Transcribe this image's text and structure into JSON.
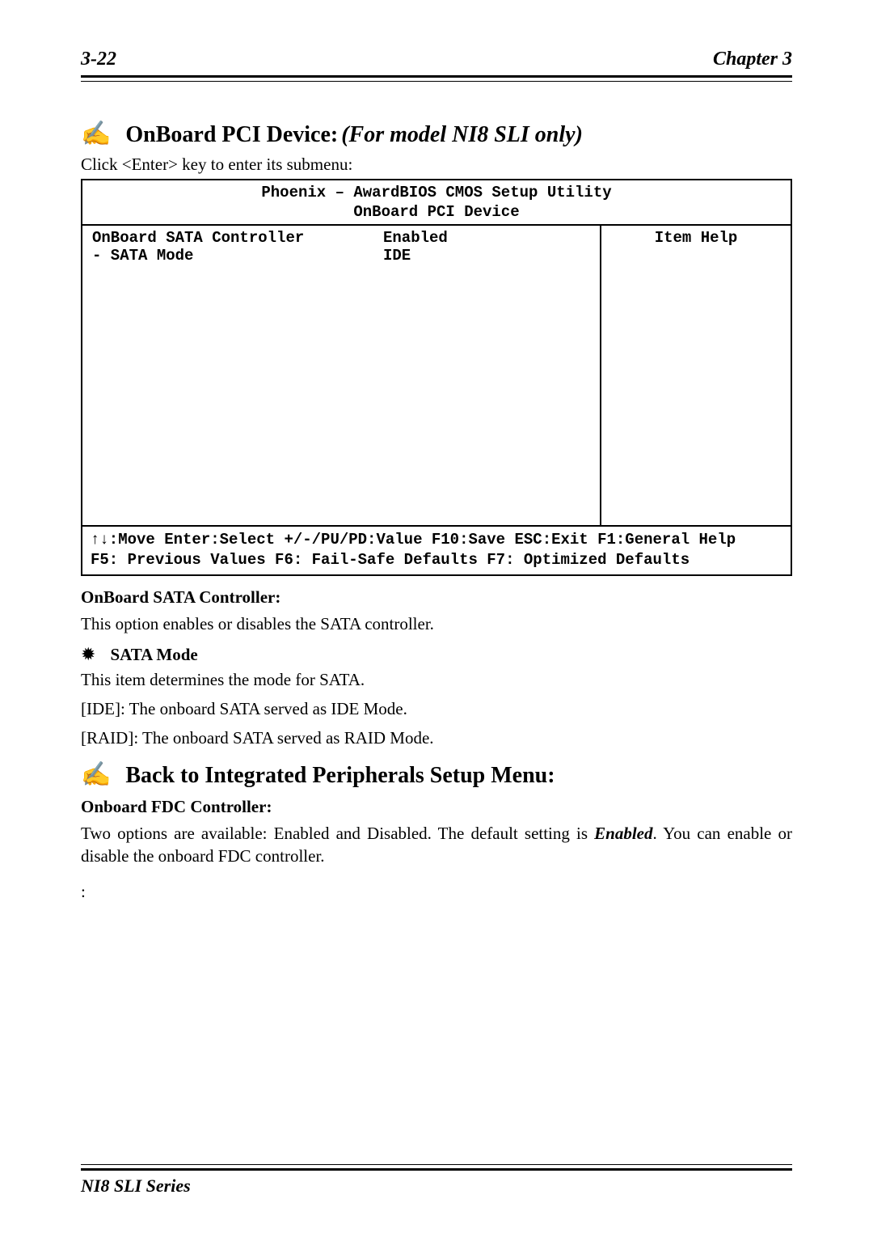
{
  "header": {
    "page_num": "3-22",
    "chapter": "Chapter 3"
  },
  "sec1": {
    "icon": "✍",
    "title": "OnBoard PCI Device:",
    "subtitle": "(For model NI8 SLI only)",
    "intro": "Click <Enter> key to enter its submenu:"
  },
  "bios": {
    "title_line1": "Phoenix – AwardBIOS CMOS Setup Utility",
    "title_line2": "OnBoard PCI Device",
    "row1_label": "OnBoard SATA Controller",
    "row1_value": "Enabled",
    "row2_label": "- SATA Mode",
    "row2_value": "IDE",
    "help_header": "Item Help",
    "footer_line1": "↑↓:Move Enter:Select +/-/PU/PD:Value F10:Save ESC:Exit F1:General Help",
    "footer_line2": "F5: Previous Values   F6: Fail-Safe Defaults   F7: Optimized Defaults"
  },
  "sata_ctrl": {
    "heading": "OnBoard SATA Controller:",
    "desc": "This option enables or disables the SATA controller."
  },
  "sata_mode": {
    "star": "✹",
    "label": "SATA Mode",
    "l1": "This item determines the mode for SATA.",
    "l2": "[IDE]: The onboard SATA served as IDE Mode.",
    "l3": "[RAID]: The onboard SATA served as RAID Mode."
  },
  "sec2": {
    "icon": "✍",
    "title": "Back to Integrated Peripherals Setup Menu:"
  },
  "fdc": {
    "heading": "Onboard FDC Controller:",
    "desc_pre": "Two options are available: Enabled and Disabled. The default setting is ",
    "emph": "Enabled",
    "desc_post": ". You can enable or disable the onboard FDC controller."
  },
  "trailing_colon": ":",
  "footer": {
    "series": "NI8 SLI Series"
  }
}
